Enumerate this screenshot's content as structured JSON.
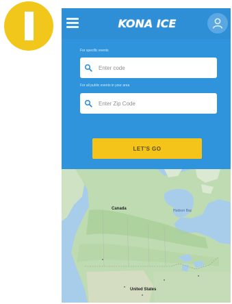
{
  "step_badge": {
    "number": "1",
    "color": "#f2c71b"
  },
  "header": {
    "menu_icon": "hamburger-menu-icon",
    "logo_text": "KONA ICE",
    "account_icon": "user-account-icon",
    "background": "#2f8fd6"
  },
  "search": {
    "code_label": "For specific events",
    "code_placeholder": "Enter code",
    "zip_label": "For all public events in your area",
    "zip_placeholder": "Enter Zip Code",
    "search_icon": "search-icon",
    "button_label": "LET'S GO",
    "button_color": "#f4c41a"
  },
  "map": {
    "labels": {
      "canada": "Canada",
      "hudson_bay": "Hudson Bay",
      "united_states": "United States"
    }
  }
}
